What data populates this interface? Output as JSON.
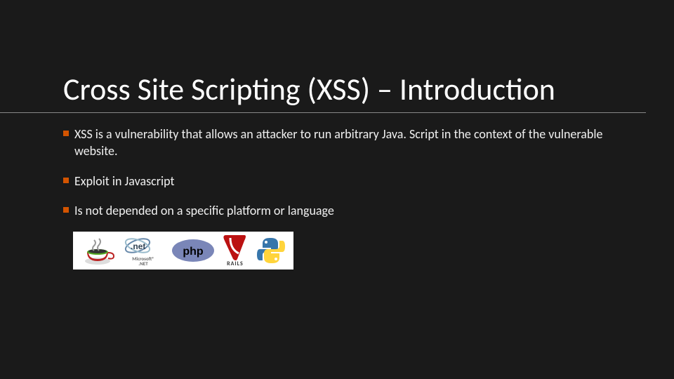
{
  "title": "Cross Site Scripting (XSS) – Introduction",
  "bullets": [
    "XSS is a vulnerability that allows an attacker to run arbitrary Java. Script in the context of the vulnerable website.",
    "Exploit in Javascript",
    "Is not depended on a specific platform or language"
  ],
  "logos": [
    {
      "name": "java",
      "label": "Java"
    },
    {
      "name": "dotnet",
      "label": ".NET",
      "sublabel": "Microsoft"
    },
    {
      "name": "php",
      "label": "php"
    },
    {
      "name": "rails",
      "label": "RAILS"
    },
    {
      "name": "python",
      "label": "Python"
    }
  ],
  "colors": {
    "accent": "#d35400",
    "background": "#1a1a1a",
    "text": "#eeeeee"
  }
}
